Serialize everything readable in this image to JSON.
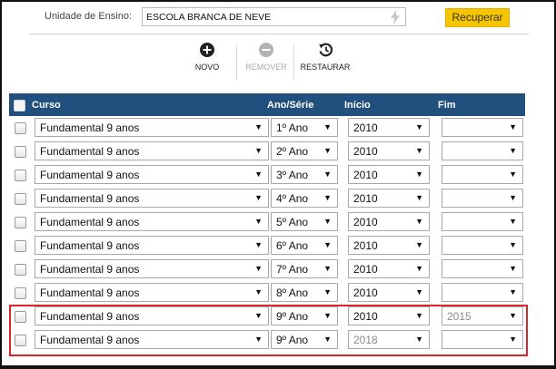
{
  "unit": {
    "label": "Unidade de Ensino:",
    "value": "ESCOLA BRANCA DE NEVE",
    "button": "Recuperar"
  },
  "toolbar": {
    "novo": "NOVO",
    "remover": "REMOVER",
    "restaurar": "RESTAURAR"
  },
  "table": {
    "headers": {
      "curso": "Curso",
      "ano": "Ano/Série",
      "inicio": "Início",
      "fim": "Fim"
    },
    "rows": [
      {
        "curso": "Fundamental 9 anos",
        "ano": "1º Ano",
        "inicio": "2010",
        "fim": ""
      },
      {
        "curso": "Fundamental 9 anos",
        "ano": "2º Ano",
        "inicio": "2010",
        "fim": ""
      },
      {
        "curso": "Fundamental 9 anos",
        "ano": "3º Ano",
        "inicio": "2010",
        "fim": ""
      },
      {
        "curso": "Fundamental 9 anos",
        "ano": "4º Ano",
        "inicio": "2010",
        "fim": ""
      },
      {
        "curso": "Fundamental 9 anos",
        "ano": "5º Ano",
        "inicio": "2010",
        "fim": ""
      },
      {
        "curso": "Fundamental 9 anos",
        "ano": "6º Ano",
        "inicio": "2010",
        "fim": ""
      },
      {
        "curso": "Fundamental 9 anos",
        "ano": "7º Ano",
        "inicio": "2010",
        "fim": ""
      },
      {
        "curso": "Fundamental 9 anos",
        "ano": "8º Ano",
        "inicio": "2010",
        "fim": ""
      },
      {
        "curso": "Fundamental 9 anos",
        "ano": "9º Ano",
        "inicio": "2010",
        "fim": "2015"
      },
      {
        "curso": "Fundamental 9 anos",
        "ano": "9º Ano",
        "inicio": "2018",
        "fim": ""
      }
    ]
  },
  "colors": {
    "header_bg": "#214f7e",
    "button_bg": "#f7c400",
    "highlight": "#d9242c"
  },
  "icons": {
    "novo": "plus-circle-icon",
    "remover": "minus-circle-icon",
    "restaurar": "history-icon",
    "unit_field": "bolt-icon"
  }
}
